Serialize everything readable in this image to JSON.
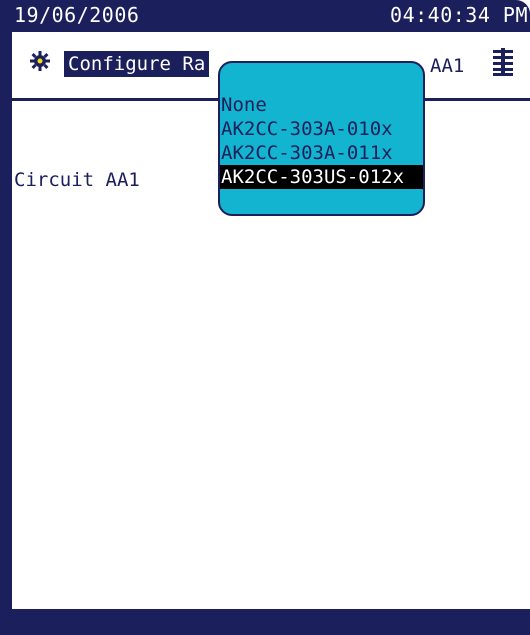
{
  "status_bar": {
    "date": "19/06/2006",
    "time": "04:40:34 PM"
  },
  "title_bar": {
    "icon": "gear-icon",
    "title": "Configure Ra",
    "suffix": "AA1",
    "menu_icon": "grid-icon"
  },
  "content": {
    "circuit_label": "Circuit AA1"
  },
  "dropdown": {
    "options": [
      {
        "label": "None"
      },
      {
        "label": "AK2CC-303A-010x"
      },
      {
        "label": "AK2CC-303A-011x"
      },
      {
        "label": "AK2CC-303US-012x"
      }
    ],
    "selected_index": 3
  },
  "colors": {
    "frame": "#1b1f5c",
    "popup": "#12b4cf",
    "selection": "#000000"
  }
}
